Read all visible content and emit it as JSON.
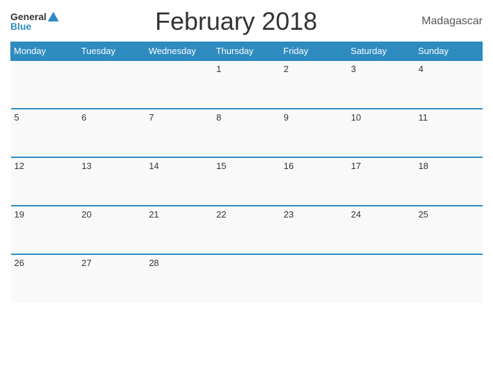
{
  "header": {
    "title": "February 2018",
    "country": "Madagascar",
    "logo_general": "General",
    "logo_blue": "Blue"
  },
  "weekdays": [
    "Monday",
    "Tuesday",
    "Wednesday",
    "Thursday",
    "Friday",
    "Saturday",
    "Sunday"
  ],
  "weeks": [
    [
      null,
      null,
      null,
      1,
      2,
      3,
      4
    ],
    [
      5,
      6,
      7,
      8,
      9,
      10,
      11
    ],
    [
      12,
      13,
      14,
      15,
      16,
      17,
      18
    ],
    [
      19,
      20,
      21,
      22,
      23,
      24,
      25
    ],
    [
      26,
      27,
      28,
      null,
      null,
      null,
      null
    ]
  ]
}
